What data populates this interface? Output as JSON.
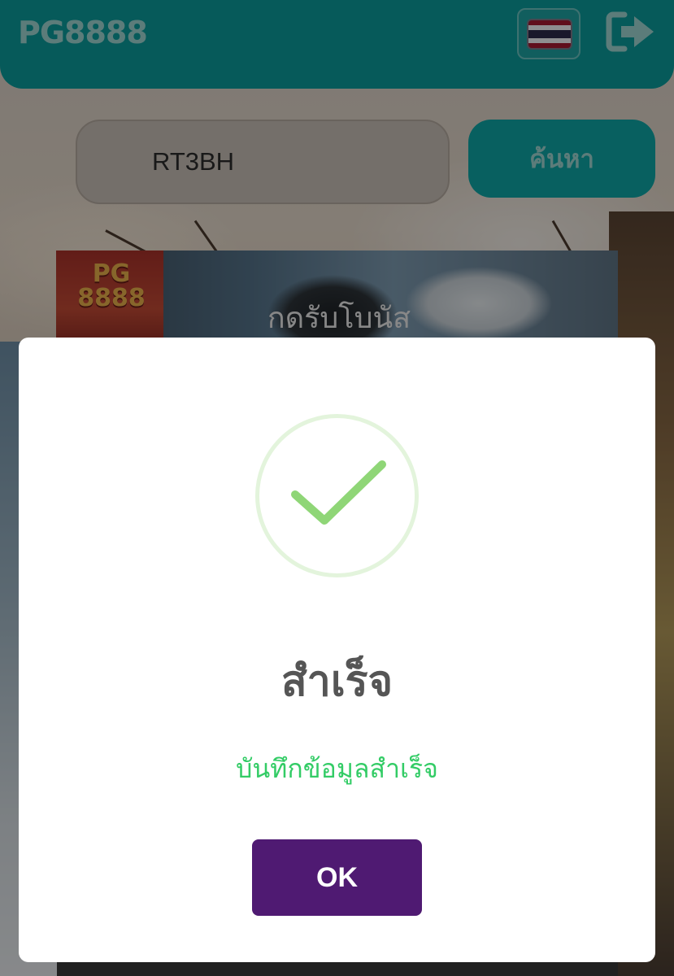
{
  "header": {
    "logo_text": "PG8888",
    "flag": "thailand-flag-icon",
    "logout_icon": "logout-icon",
    "color": "#0b9b9b"
  },
  "search": {
    "value": "RT3BH",
    "button_label": "ค้นหา"
  },
  "banner": {
    "logo_text": "PG 8888",
    "label": "กดรับโบนัส"
  },
  "modal": {
    "icon": "check-circle-icon",
    "title": "สำเร็จ",
    "message": "บันทึกข้อมูลสำเร็จ",
    "ok_label": "OK",
    "accent_color": "#4f1a72",
    "success_color": "#8fd677"
  }
}
